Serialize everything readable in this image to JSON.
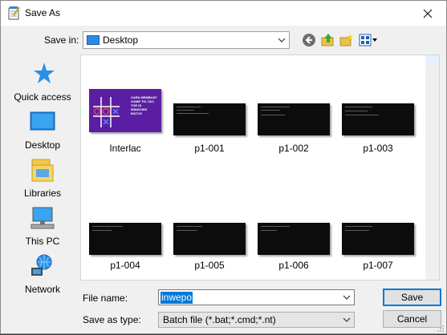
{
  "window": {
    "title": "Save As"
  },
  "toolbar": {
    "save_in_label": "Save in:",
    "save_in_value": "Desktop",
    "icons": [
      "back-arrow-icon",
      "up-folder-icon",
      "new-folder-icon",
      "view-menu-icon"
    ]
  },
  "places": [
    {
      "label": "Quick access",
      "icon": "star-icon"
    },
    {
      "label": "Desktop",
      "icon": "desktop-icon"
    },
    {
      "label": "Libraries",
      "icon": "libraries-icon"
    },
    {
      "label": "This PC",
      "icon": "computer-icon"
    },
    {
      "label": "Network",
      "icon": "network-icon"
    }
  ],
  "files": [
    {
      "name": "Interlac",
      "thumb_text": "CARA MEMBUAT GAME TIC-TAC-TOE DI WINDOWS BATCH"
    },
    {
      "name": "p1-001"
    },
    {
      "name": "p1-002"
    },
    {
      "name": "p1-003"
    },
    {
      "name": "p1-004"
    },
    {
      "name": "p1-005"
    },
    {
      "name": "p1-006"
    },
    {
      "name": "p1-007"
    }
  ],
  "form": {
    "file_name_label": "File name:",
    "file_name_value": "inwepo",
    "save_type_label": "Save as type:",
    "save_type_value": "Batch file (*.bat;*.cmd;*.nt)"
  },
  "buttons": {
    "save": "Save",
    "cancel": "Cancel"
  },
  "colors": {
    "accent": "#0078d7",
    "interlac_bg": "#5b1ea2",
    "folder_blue": "#2b8be0"
  }
}
